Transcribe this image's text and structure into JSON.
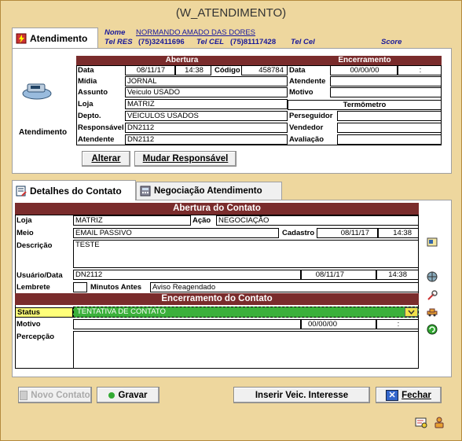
{
  "window": {
    "title": "(W_ATENDIMENTO)"
  },
  "header": {
    "tab_label": "Atendimento",
    "nome_label": "Nome",
    "nome_value": "NORMANDO AMADO DAS DORES",
    "telres_label": "Tel RES",
    "telres_value": "(75)32411696",
    "telcel_label": "Tel CEL",
    "telcel_value": "(75)81117428",
    "telcel2_label": "Tel Cel",
    "score_label": "Score"
  },
  "atendimento": {
    "side_label": "Atendimento",
    "abertura_title": "Abertura",
    "encerramento_title": "Encerramento",
    "data_label": "Data",
    "data_value": "08/11/17",
    "hora_value": "14:38",
    "codigo_label": "Código",
    "codigo_value": "458784",
    "midia_label": "Mídia",
    "midia_value": "JORNAL",
    "assunto_label": "Assunto",
    "assunto_value": "Veiculo USADO",
    "loja_label": "Loja",
    "loja_value": "MATRIZ",
    "depto_label": "Depto.",
    "depto_value": "VEICULOS USADOS",
    "responsavel_label": "Responsável",
    "responsavel_value": "DN2112",
    "atendente_label": "Atendente",
    "atendente_value": "DN2112",
    "enc_data_label": "Data",
    "enc_data_value": "00/00/00",
    "enc_hora_value": ":",
    "enc_atendente_label": "Atendente",
    "enc_motivo_label": "Motivo",
    "termometro_title": "Termômetro",
    "perseguidor_label": "Perseguidor",
    "vendedor_label": "Vendedor",
    "avaliacao_label": "Avaliação",
    "alterar_button": "Alterar",
    "mudar_button": "Mudar Responsável"
  },
  "tabs": {
    "detalhes": "Detalhes do Contato",
    "negociacao": "Negociação Atendimento"
  },
  "contato": {
    "abertura_title": "Abertura do Contato",
    "loja_label": "Loja",
    "loja_value": "MATRIZ",
    "acao_label": "Ação",
    "acao_value": "NEGOCIAÇÃO",
    "meio_label": "Meio",
    "meio_value": "EMAIL PASSIVO",
    "cadastro_label": "Cadastro",
    "cadastro_date": "08/11/17",
    "cadastro_hora": "14:38",
    "descricao_label": "Descrição",
    "descricao_value": "TESTE",
    "usuario_label": "Usuário/Data",
    "usuario_value": "DN2112",
    "usuario_date": "08/11/17",
    "usuario_hora": "14:38",
    "lembrete_label": "Lembrete",
    "minutos_label": "Minutos Antes",
    "aviso_value": "Aviso Reagendado",
    "encerramento_title": "Encerramento do Contato",
    "status_label": "Status",
    "status_value": "TENTATIVA DE CONTATO",
    "motivo_label": "Motivo",
    "motivo_date": "00/00/00",
    "motivo_hora": ":",
    "percepcao_label": "Percepção"
  },
  "footer": {
    "novo_button": "Novo Contato",
    "gravar_button": "Gravar",
    "inserir_button": "Inserir Veic. Interesse",
    "fechar_button": "Fechar"
  },
  "colors": {
    "band": "#7a2c2c",
    "window": "#eed79e",
    "status": "#3bb03b"
  }
}
